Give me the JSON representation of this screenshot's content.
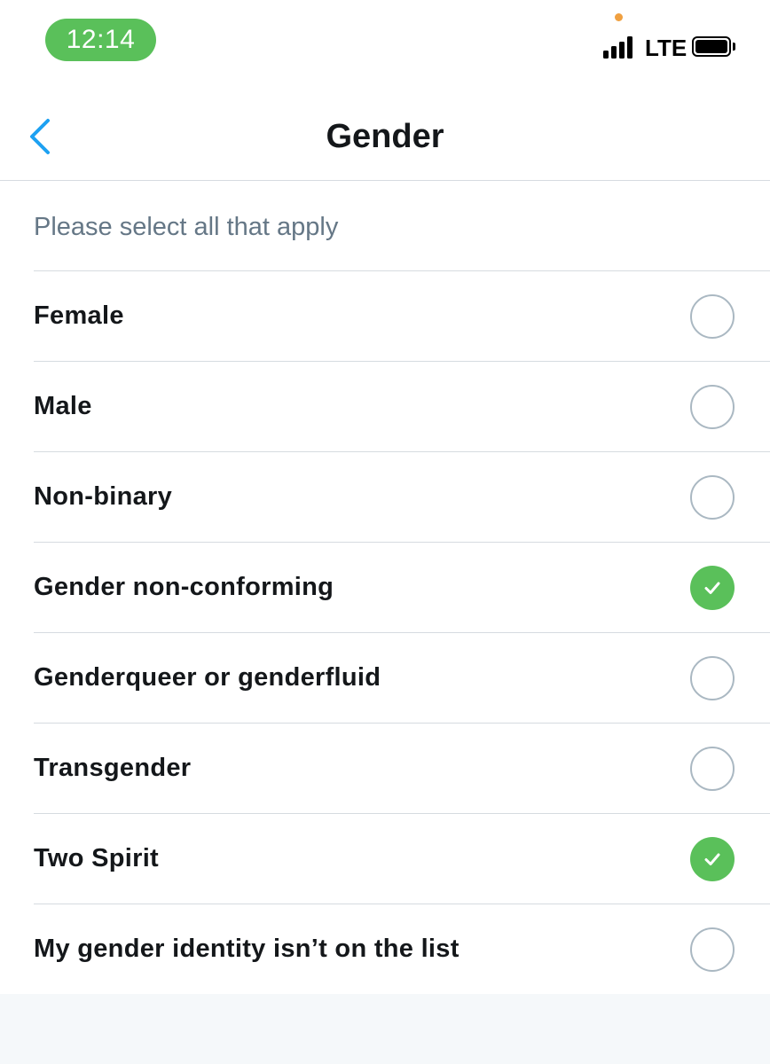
{
  "status_bar": {
    "time": "12:14",
    "network": "LTE",
    "icons": [
      "signal-icon",
      "battery-icon"
    ]
  },
  "nav": {
    "title": "Gender",
    "back_icon": "chevron-left-icon"
  },
  "subtitle": "Please select all that apply",
  "options": [
    {
      "label": "Female",
      "checked": false
    },
    {
      "label": "Male",
      "checked": false
    },
    {
      "label": "Non-binary",
      "checked": false
    },
    {
      "label": "Gender non-conforming",
      "checked": true
    },
    {
      "label": "Genderqueer or genderfluid",
      "checked": false
    },
    {
      "label": "Transgender",
      "checked": false
    },
    {
      "label": "Two Spirit",
      "checked": true
    },
    {
      "label": "My gender identity isn’t on the list",
      "checked": false
    }
  ],
  "colors": {
    "accent": "#1da1f2",
    "check_green": "#5ac05a",
    "time_pill": "#5ac05a",
    "divider": "#d6dbe0",
    "unchecked_ring": "#aab8c2",
    "subtitle_text": "#657786"
  }
}
